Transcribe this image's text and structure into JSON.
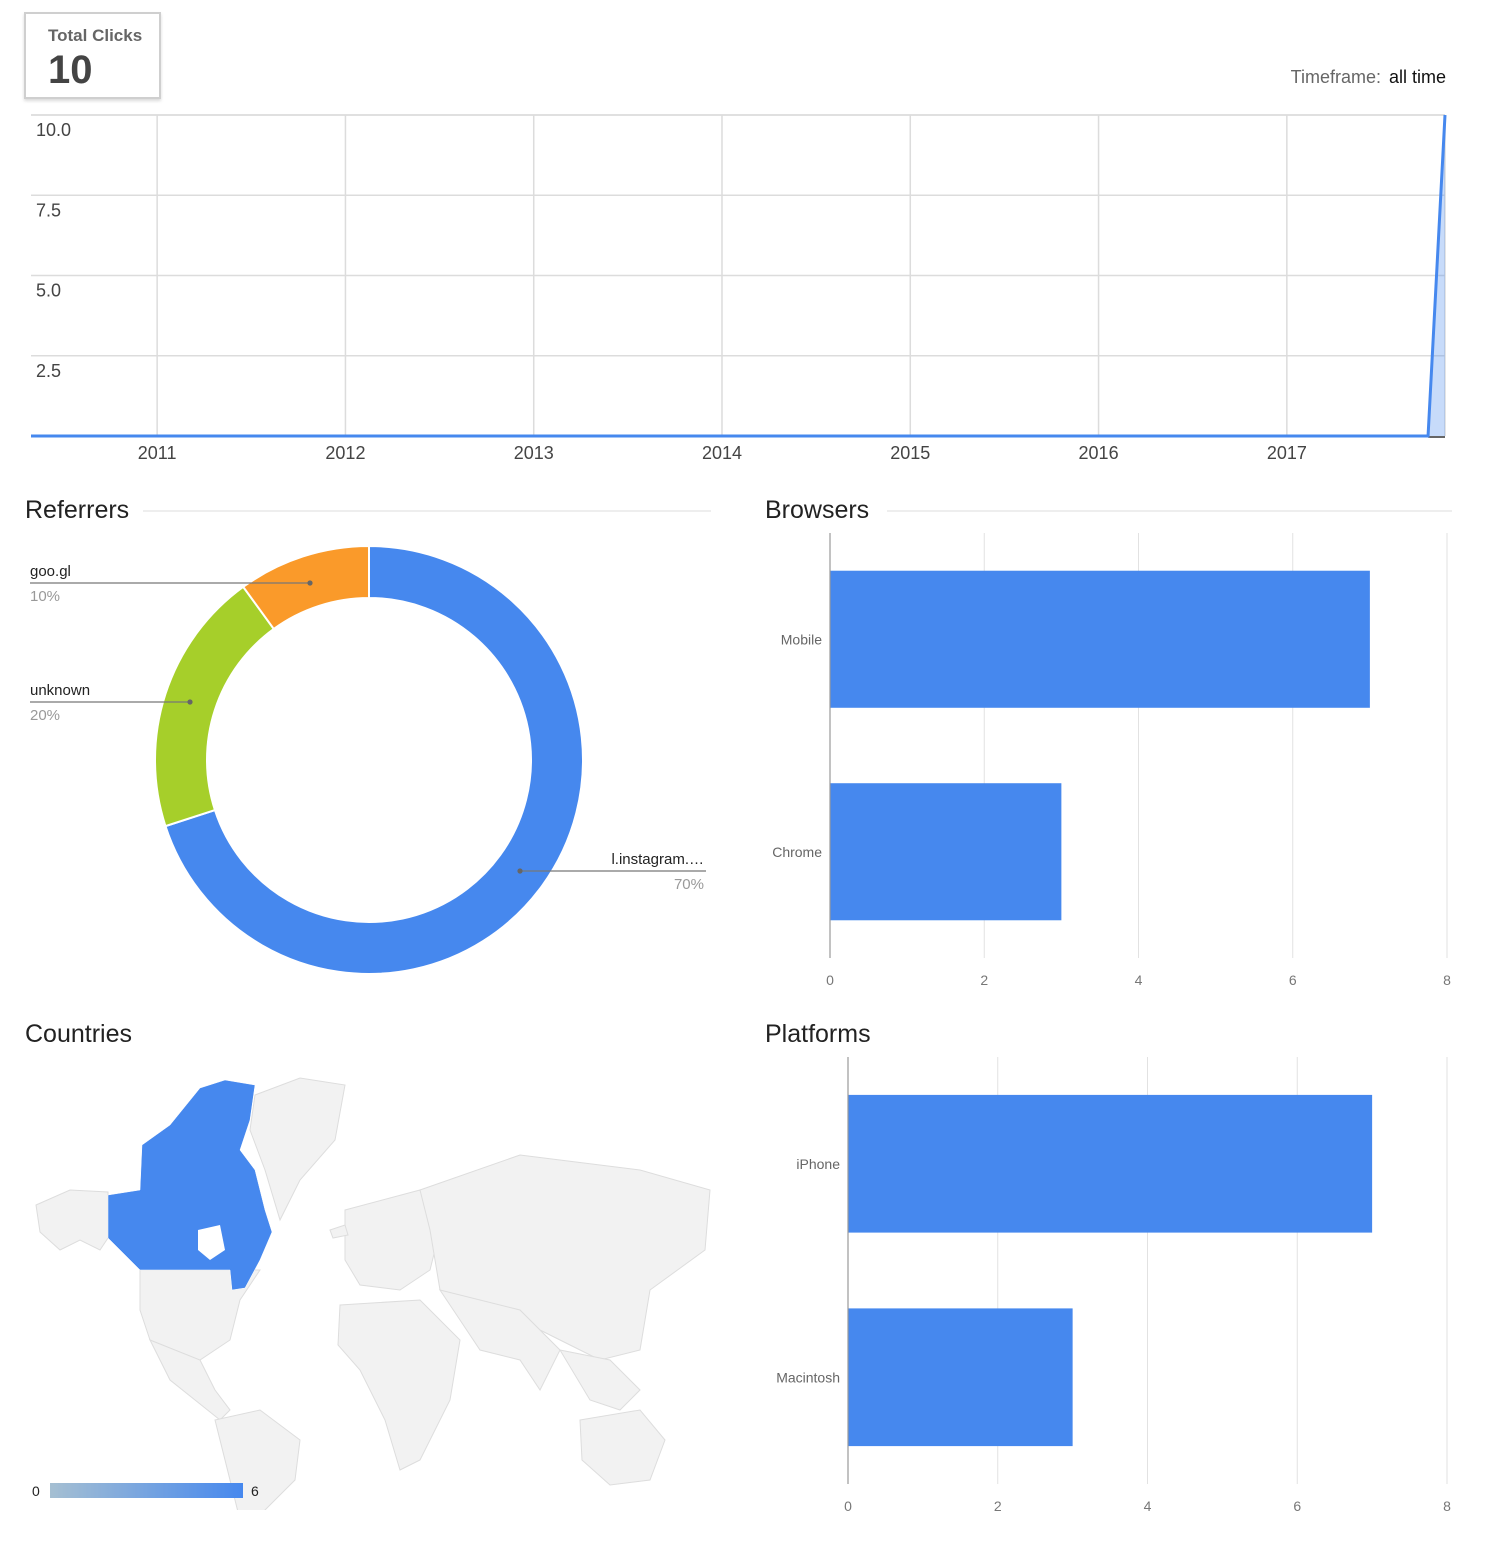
{
  "summary": {
    "total_clicks_label": "Total Clicks",
    "total_clicks_value": "10",
    "timeframe_label": "Timeframe:",
    "timeframe_value": "all time"
  },
  "colors": {
    "primary_blue": "#4688ee",
    "orange": "#fa9a2a",
    "green": "#a6cf2a",
    "grid": "#dcdcdc",
    "map_land": "#f2f2f2",
    "map_border": "#dddddd",
    "gradient_min": "#a5bfd2"
  },
  "sections": {
    "referrers": "Referrers",
    "browsers": "Browsers",
    "countries": "Countries",
    "platforms": "Platforms"
  },
  "chart_data": [
    {
      "id": "clicks-over-time",
      "type": "area",
      "title": "",
      "xlabel": "",
      "ylabel": "",
      "x_ticks": [
        "2011",
        "2012",
        "2013",
        "2014",
        "2015",
        "2016",
        "2017"
      ],
      "y_ticks": [
        "2.5",
        "5.0",
        "7.5",
        "10.0"
      ],
      "ylim": [
        0,
        10
      ],
      "xlim": [
        2010.33,
        2017.84
      ],
      "series": [
        {
          "name": "Clicks",
          "x": [
            2010.33,
            2017.75,
            2017.84
          ],
          "y": [
            0,
            0,
            10
          ]
        }
      ],
      "grid": true
    },
    {
      "id": "referrers",
      "type": "pie",
      "donut": true,
      "title": "Referrers",
      "slices": [
        {
          "label": "l.instagram.…",
          "value": 70,
          "percent_label": "70%",
          "color": "#4688ee"
        },
        {
          "label": "unknown",
          "value": 20,
          "percent_label": "20%",
          "color": "#a6cf2a"
        },
        {
          "label": "goo.gl",
          "value": 10,
          "percent_label": "10%",
          "color": "#fa9a2a"
        }
      ]
    },
    {
      "id": "browsers",
      "type": "bar",
      "orientation": "horizontal",
      "title": "Browsers",
      "categories": [
        "Mobile",
        "Chrome"
      ],
      "values": [
        7,
        3
      ],
      "x_ticks": [
        "0",
        "2",
        "4",
        "6",
        "8"
      ],
      "xlim": [
        0,
        8
      ],
      "grid": true
    },
    {
      "id": "platforms",
      "type": "bar",
      "orientation": "horizontal",
      "title": "Platforms",
      "categories": [
        "iPhone",
        "Macintosh"
      ],
      "values": [
        7,
        3
      ],
      "x_ticks": [
        "0",
        "2",
        "4",
        "6",
        "8"
      ],
      "xlim": [
        0,
        8
      ],
      "grid": true
    },
    {
      "id": "countries",
      "type": "heatmap",
      "subtype": "geo-map",
      "title": "Countries",
      "regions": [
        {
          "name": "Canada",
          "value": 6
        }
      ],
      "color_axis": {
        "min_label": "0",
        "max_label": "6",
        "min": 0,
        "max": 6
      }
    }
  ]
}
